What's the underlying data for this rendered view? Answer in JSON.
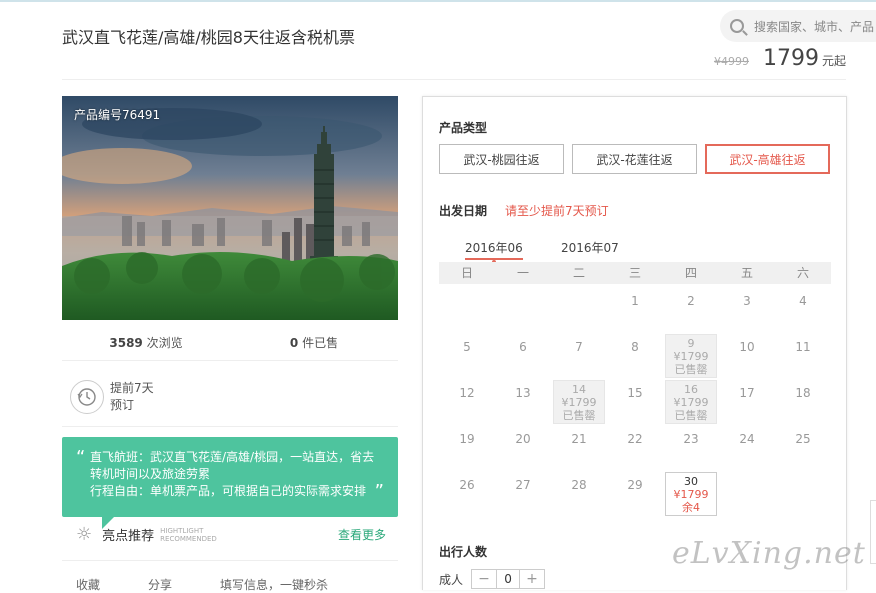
{
  "header": {
    "search_placeholder": "搜索国家、城市、产品",
    "title": "武汉直飞花莲/高雄/桃园8天往返含税机票",
    "old_price": "¥4999",
    "price": "1799",
    "price_unit": "元起"
  },
  "product": {
    "number_label": "产品编号76491",
    "views": "3589",
    "views_label": "次浏览",
    "sold": "0",
    "sold_label": "件已售",
    "advance_line1": "提前7天",
    "advance_line2": "预订",
    "intro": [
      "直飞航班：武汉直飞花莲/高雄/桃园，一站直达，省去转机时间以及旅途劳累",
      "行程自由：单机票产品，可根据自己的实际需求安排"
    ],
    "highlight_title": "亮点推荐",
    "highlight_sub1": "HIGHTLIGHT",
    "highlight_sub2": "RECOMMENDED",
    "see_more": "查看更多",
    "actions": [
      "收藏",
      "分享",
      "填写信息，一键秒杀"
    ]
  },
  "booking": {
    "type_label": "产品类型",
    "types": [
      "武汉-桃园往返",
      "武汉-花莲往返",
      "武汉-高雄往返"
    ],
    "active_type": 2,
    "date_label": "出发日期",
    "date_hint": "请至少提前7天预订",
    "months": [
      "2016年06",
      "2016年07"
    ],
    "active_month": 0,
    "weekdays": [
      "日",
      "一",
      "二",
      "三",
      "四",
      "五",
      "六"
    ],
    "calendar": [
      [
        {
          "d": ""
        },
        {
          "d": ""
        },
        {
          "d": ""
        },
        {
          "d": "1"
        },
        {
          "d": "2"
        },
        {
          "d": "3"
        },
        {
          "d": "4"
        }
      ],
      [
        {
          "d": "5"
        },
        {
          "d": "6"
        },
        {
          "d": "7"
        },
        {
          "d": "8"
        },
        {
          "d": "9",
          "state": "sold",
          "price": "¥1799",
          "note": "已售罄"
        },
        {
          "d": "10"
        },
        {
          "d": "11"
        }
      ],
      [
        {
          "d": "12"
        },
        {
          "d": "13"
        },
        {
          "d": "14",
          "state": "sold",
          "price": "¥1799",
          "note": "已售罄"
        },
        {
          "d": "15"
        },
        {
          "d": "16",
          "state": "sold",
          "price": "¥1799",
          "note": "已售罄"
        },
        {
          "d": "17"
        },
        {
          "d": "18"
        }
      ],
      [
        {
          "d": "19"
        },
        {
          "d": "20"
        },
        {
          "d": "21"
        },
        {
          "d": "22"
        },
        {
          "d": "23"
        },
        {
          "d": "24"
        },
        {
          "d": "25"
        }
      ],
      [
        {
          "d": "26"
        },
        {
          "d": "27"
        },
        {
          "d": "28"
        },
        {
          "d": "29"
        },
        {
          "d": "30",
          "state": "avail",
          "price": "¥1799",
          "note": "余4"
        },
        {
          "d": ""
        },
        {
          "d": ""
        }
      ]
    ],
    "pax_label": "出行人数",
    "adult_label": "成人",
    "adult_count": "0",
    "minus": "−",
    "plus": "+"
  },
  "watermark": "eLvXing.net",
  "colors": {
    "accent": "#e4574a",
    "green": "#4ec49e"
  }
}
